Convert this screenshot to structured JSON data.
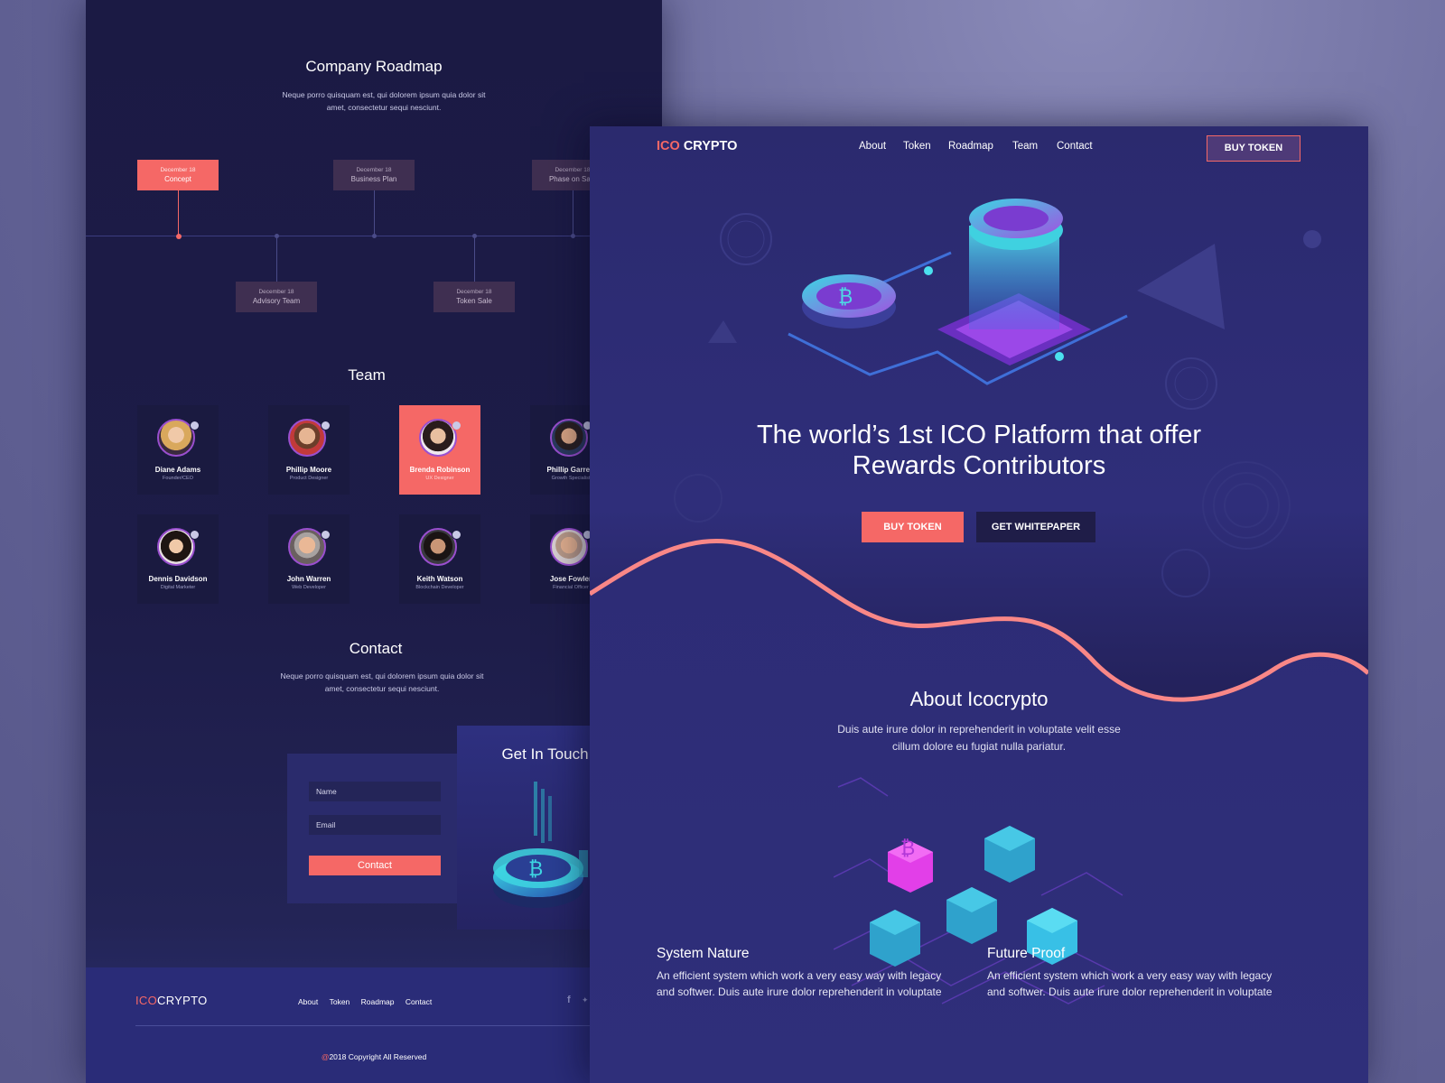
{
  "left": {
    "roadmap": {
      "title": "Company Roadmap",
      "subtitle_lines": [
        "Neque porro quisquam est, qui dolorem ipsum quia dolor sit",
        "amet, consectetur sequi nesciunt."
      ],
      "items": [
        {
          "date": "December 18",
          "label": "Concept",
          "active": true
        },
        {
          "date": "December 18",
          "label": "Business Plan",
          "active": false
        },
        {
          "date": "December 18",
          "label": "Phase on Sale",
          "active": false
        },
        {
          "date": "December 18",
          "label": "Advisory Team",
          "active": false
        },
        {
          "date": "December 18",
          "label": "Token Sale",
          "active": false
        }
      ]
    },
    "team": {
      "title": "Team",
      "members": [
        {
          "name": "Diane Adams",
          "role": "Founder/CEO"
        },
        {
          "name": "Phillip Moore",
          "role": "Product Designer"
        },
        {
          "name": "Brenda Robinson",
          "role": "UX Designer"
        },
        {
          "name": "Phillip Garrett",
          "role": "Growth Specialist"
        },
        {
          "name": "Dennis Davidson",
          "role": "Digital Marketer"
        },
        {
          "name": "John Warren",
          "role": "Web Developer"
        },
        {
          "name": "Keith Watson",
          "role": "Blockchain Developer"
        },
        {
          "name": "Jose Fowler",
          "role": "Financial Officer"
        }
      ]
    },
    "contact": {
      "title": "Contact",
      "subtitle_lines": [
        "Neque porro quisquam est, qui dolorem ipsum quia dolor sit",
        "amet, consectetur sequi nesciunt."
      ],
      "name_placeholder": "Name",
      "email_placeholder": "Email",
      "button": "Contact",
      "get_in_touch": "Get In Touch"
    },
    "footer": {
      "logo_accent": "ICO",
      "logo_rest": "CRYPTO",
      "links": [
        "About",
        "Token",
        "Roadmap",
        "Contact"
      ],
      "social_icons": [
        "facebook-icon",
        "twitter-icon"
      ],
      "copyright_symbol": "@",
      "copyright": "2018 Copyright All Reserved"
    }
  },
  "right": {
    "logo_accent": "ICO",
    "logo_rest": "CRYPTO",
    "nav": [
      "About",
      "Token",
      "Roadmap",
      "Team",
      "Contact"
    ],
    "nav_button": "BUY TOKEN",
    "hero": {
      "title_line1": "The world’s 1st ICO Platform that offer",
      "title_line2": "Rewards Contributors",
      "buy_button": "BUY TOKEN",
      "whitepaper_button": "GET WHITEPAPER"
    },
    "about": {
      "title": "About Icocrypto",
      "text_line1": "Duis aute irure dolor in reprehenderit in voluptate velit esse",
      "text_line2": "cillum dolore eu fugiat nulla pariatur."
    },
    "features": [
      {
        "title": "System Nature",
        "text_line1": "An efficient system which work  a very easy way with legacy",
        "text_line2": "and softwer. Duis aute irure dolor reprehenderit in voluptate"
      },
      {
        "title": "Future Proof",
        "text_line1": "An efficient system which work  a very easy way with legacy",
        "text_line2": "and softwer. Duis aute irure dolor reprehenderit in voluptate"
      }
    ]
  },
  "colors": {
    "accent": "#f56866",
    "dark_bg": "#1b1a44",
    "hero_bg": "#2b2a6e",
    "card_bg": "#1a1a40"
  }
}
